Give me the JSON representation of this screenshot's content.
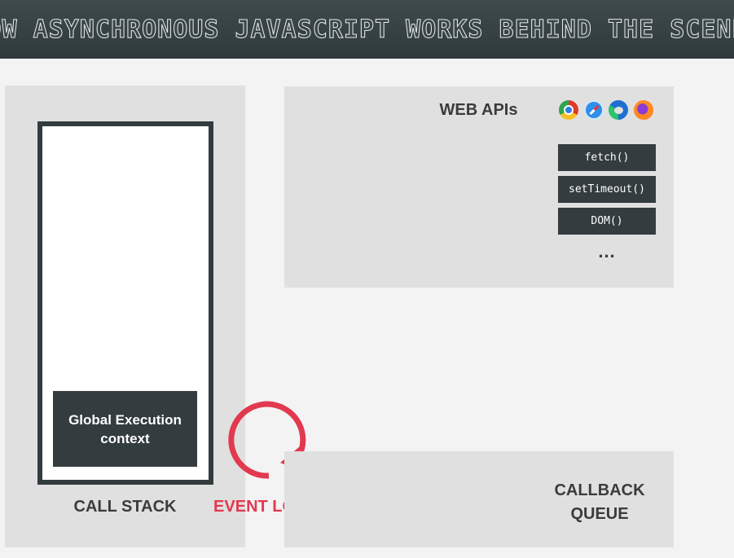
{
  "title": "HOW ASYNCHRONOUS JAVASCRIPT WORKS BEHIND THE SCENES",
  "call_stack": {
    "label": "CALL STACK",
    "frame": "Global Execution context"
  },
  "web_apis": {
    "title": "WEB APIs",
    "browser_icons": [
      "chrome-icon",
      "safari-icon",
      "edge-icon",
      "firefox-icon"
    ],
    "apis": [
      "fetch()",
      "setTimeout()",
      "DOM()"
    ],
    "more": "..."
  },
  "event_loop": {
    "label": "EVENT LOOP",
    "color": "#e2394f"
  },
  "callback_queue": {
    "label": "CALLBACK QUEUE"
  },
  "colors": {
    "header": "#323c3e",
    "panel": "#e0e0e0",
    "dark_box": "#333c3e",
    "background": "#f3f3f3"
  }
}
